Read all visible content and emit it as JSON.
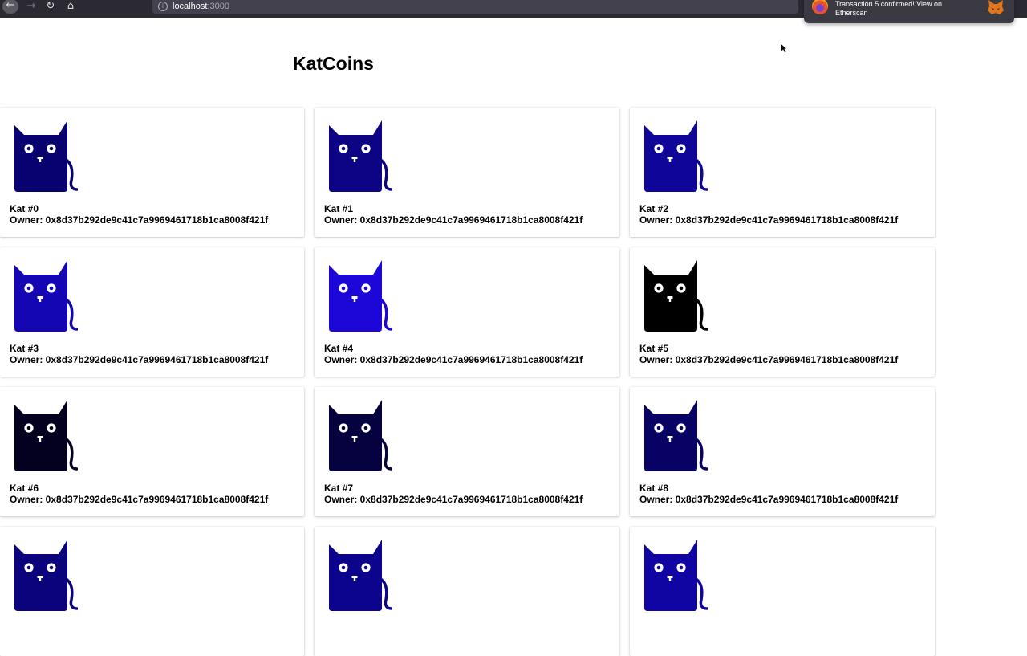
{
  "browser": {
    "url_host": "localhost",
    "url_port": ":3000"
  },
  "notification": {
    "text": "Transaction 5 confirmed! View on Etherscan"
  },
  "page": {
    "title": "KatCoins"
  },
  "kats": [
    {
      "name": "Kat #0",
      "owner": "Owner: 0x8d37b292de9c41c7a9969461718b1ca8008f421f",
      "color": "#080270"
    },
    {
      "name": "Kat #1",
      "owner": "Owner: 0x8d37b292de9c41c7a9969461718b1ca8008f421f",
      "color": "#0c0485"
    },
    {
      "name": "Kat #2",
      "owner": "Owner: 0x8d37b292de9c41c7a9969461718b1ca8008f421f",
      "color": "#0f0599"
    },
    {
      "name": "Kat #3",
      "owner": "Owner: 0x8d37b292de9c41c7a9969461718b1ca8008f421f",
      "color": "#1406b3"
    },
    {
      "name": "Kat #4",
      "owner": "Owner: 0x8d37b292de9c41c7a9969461718b1ca8008f421f",
      "color": "#1d06d8"
    },
    {
      "name": "Kat #5",
      "owner": "Owner: 0x8d37b292de9c41c7a9969461718b1ca8008f421f",
      "color": "#000000"
    },
    {
      "name": "Kat #6",
      "owner": "Owner: 0x8d37b292de9c41c7a9969461718b1ca8008f421f",
      "color": "#03011f"
    },
    {
      "name": "Kat #7",
      "owner": "Owner: 0x8d37b292de9c41c7a9969461718b1ca8008f421f",
      "color": "#060240"
    },
    {
      "name": "Kat #8",
      "owner": "Owner: 0x8d37b292de9c41c7a9969461718b1ca8008f421f",
      "color": "#080265"
    },
    {
      "name": "",
      "owner": "",
      "color": "#0b037c"
    },
    {
      "name": "",
      "owner": "",
      "color": "#0d048e"
    },
    {
      "name": "",
      "owner": "",
      "color": "#1005a3"
    }
  ]
}
